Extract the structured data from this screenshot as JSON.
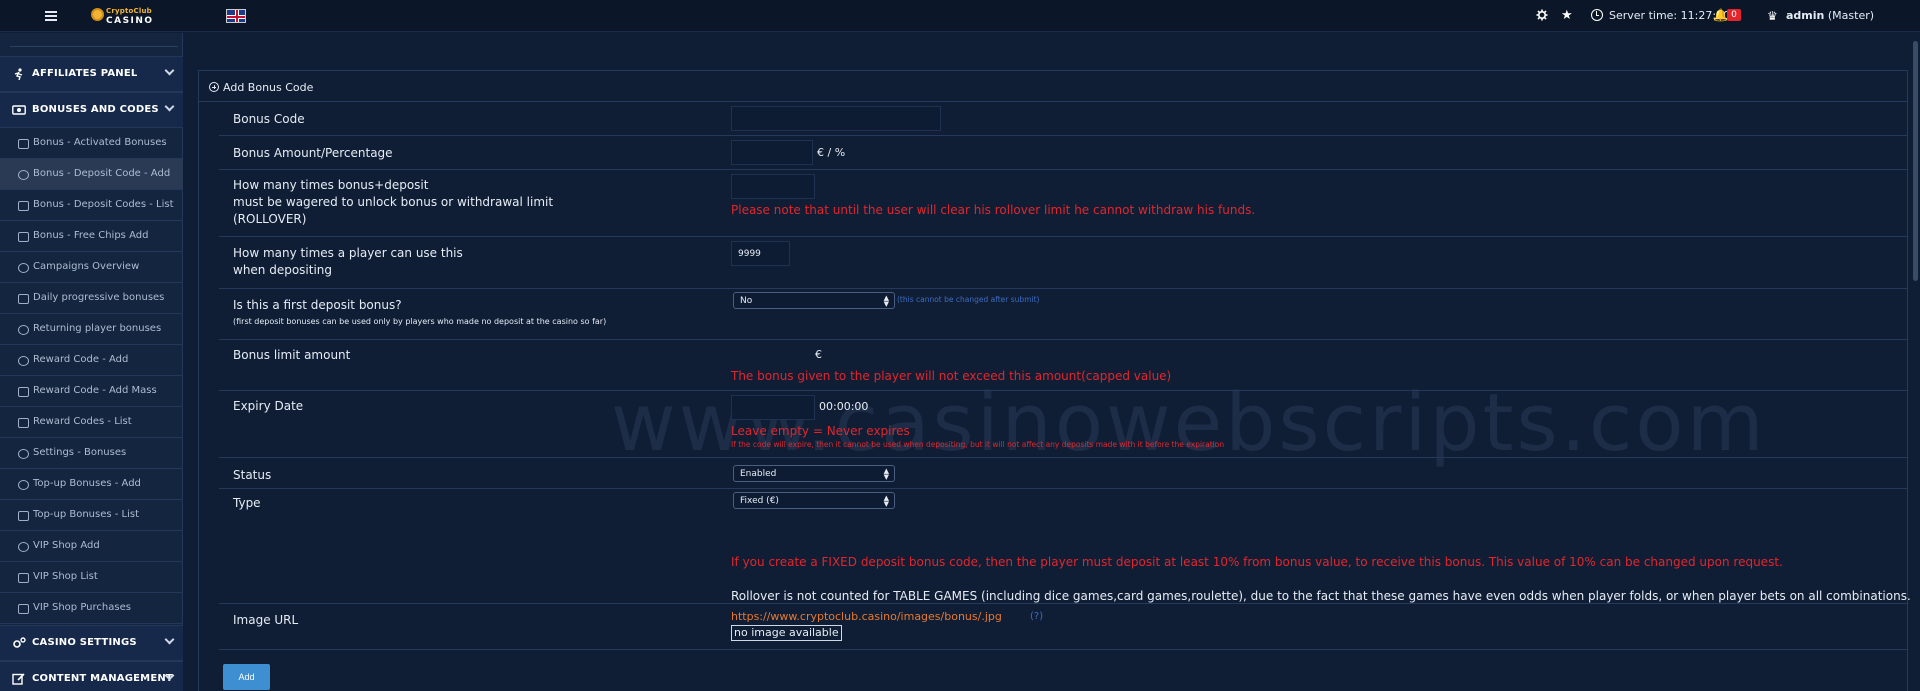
{
  "topbar": {
    "logo_line1": "CryptoClub",
    "logo_line2": "CASINO",
    "server_time": "Server time: 11:27:30",
    "notification_count": "0",
    "user_name": "admin",
    "user_role": "(Master)"
  },
  "sidebar": {
    "sections": [
      {
        "label": "AFFILIATES PANEL"
      },
      {
        "label": "BONUSES AND CODES"
      },
      {
        "label": "CASINO SETTINGS"
      },
      {
        "label": "CONTENT MANAGEMENT"
      }
    ],
    "items": [
      {
        "label": "Bonus - Activated Bonuses",
        "active": false
      },
      {
        "label": "Bonus - Deposit Code - Add",
        "active": true
      },
      {
        "label": "Bonus - Deposit Codes - List",
        "active": false
      },
      {
        "label": "Bonus - Free Chips Add",
        "active": false
      },
      {
        "label": "Campaigns Overview",
        "active": false
      },
      {
        "label": "Daily progressive bonuses",
        "active": false
      },
      {
        "label": "Returning player bonuses",
        "active": false
      },
      {
        "label": "Reward Code - Add",
        "active": false
      },
      {
        "label": "Reward Code - Add Mass",
        "active": false
      },
      {
        "label": "Reward Codes - List",
        "active": false
      },
      {
        "label": "Settings - Bonuses",
        "active": false
      },
      {
        "label": "Top-up Bonuses - Add",
        "active": false
      },
      {
        "label": "Top-up Bonuses - List",
        "active": false
      },
      {
        "label": "VIP Shop Add",
        "active": false
      },
      {
        "label": "VIP Shop List",
        "active": false
      },
      {
        "label": "VIP Shop Purchases",
        "active": false
      }
    ]
  },
  "form": {
    "title": "Add Bonus Code",
    "watermark": "www.casinowebscripts.com",
    "bonus_code": {
      "label": "Bonus Code",
      "value": ""
    },
    "bonus_amount": {
      "label": "Bonus Amount/Percentage",
      "value": "",
      "suffix": "€ / %"
    },
    "rollover": {
      "label_line1": "How many times bonus+deposit",
      "label_line2": "must be wagered to unlock bonus or withdrawal limit",
      "label_line3": "(ROLLOVER)",
      "value": "",
      "note": "Please note that until the user will clear his rollover limit he cannot withdraw his funds."
    },
    "uses": {
      "label_line1": "How many times a player can use this",
      "label_line2": "when depositing",
      "value": "9999"
    },
    "first_deposit": {
      "label": "Is this a first deposit bonus?",
      "sublabel": "(first deposit bonuses can be used only by players who made no deposit at the casino so far)",
      "selected": "No",
      "hint": "(this cannot be changed after submit)"
    },
    "limit": {
      "label": "Bonus limit amount",
      "suffix": "€",
      "note": "The bonus given to the player will not exceed this amount(capped value)"
    },
    "expiry": {
      "label": "Expiry Date",
      "value": "",
      "time": "00:00:00",
      "note": "Leave empty = Never expires",
      "subnote": "If the code will expire, then it cannot be used when depositing, but it will not affect any deposits made with it before the expiration"
    },
    "status": {
      "label": "Status",
      "selected": "Enabled"
    },
    "type": {
      "label": "Type",
      "selected": "Fixed (€)",
      "note": "If you create a FIXED deposit bonus code, then the player must deposit at least 10% from bonus value, to receive this bonus. This value of 10% can be changed upon request.",
      "rollover_note": "Rollover is not counted for TABLE GAMES (including dice games,card games,roulette), due to the fact that these games have even odds when player folds, or when player bets on all combinations."
    },
    "image": {
      "label": "Image URL",
      "url": "https://www.cryptoclub.casino/images/bonus/.jpg",
      "help": "(?)",
      "no_image": "no image available"
    },
    "submit_label": "Add"
  },
  "colors": {
    "accent": "#3d8fd1",
    "warning": "#e4252c",
    "link": "#e8792f",
    "badge": "#e4252c"
  }
}
